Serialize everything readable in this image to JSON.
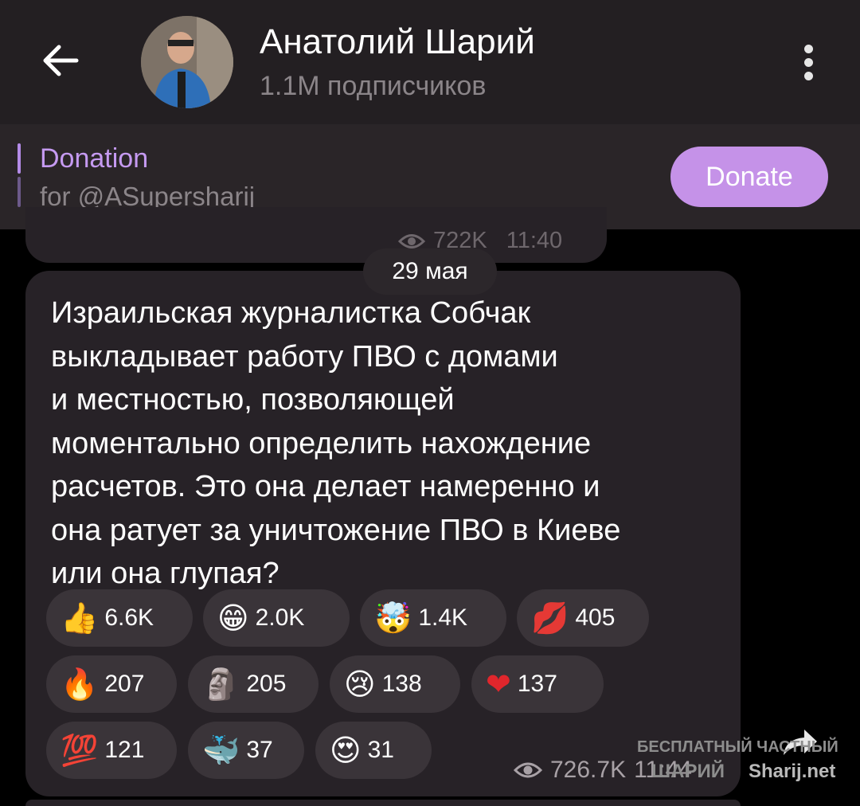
{
  "header": {
    "title": "Анатолий Шарий",
    "subtitle": "1.1M подписчиков",
    "back_icon": "arrow-left-icon",
    "menu_icon": "more-vertical-icon"
  },
  "pinned": {
    "title": "Donation",
    "subtitle": "for @ASupersharij",
    "button_label": "Donate",
    "accent": "#c592e8"
  },
  "previous_message": {
    "views": "722K",
    "time": "11:40"
  },
  "date_separator": "29 мая",
  "message": {
    "lines": [
      "Израильская журналистка Собчак",
      "выкладывает работу ПВО с домами",
      "и местностью, позволяющей",
      "моментально определить нахождение",
      "расчетов. Это она делает намеренно и",
      "она ратует за уничтожение ПВО в Киеве",
      "или она глупая?"
    ],
    "views": "726.7K",
    "time": "11:44",
    "reactions": [
      {
        "emoji": "👍",
        "count": "6.6K"
      },
      {
        "emoji": "😁",
        "count": "2.0K"
      },
      {
        "emoji": "🤯",
        "count": "1.4K"
      },
      {
        "emoji": "💋",
        "count": "405"
      },
      {
        "emoji": "🔥",
        "count": "207"
      },
      {
        "emoji": "🗿",
        "count": "205"
      },
      {
        "emoji": "😢",
        "count": "138"
      },
      {
        "emoji": "❤",
        "count": "137"
      },
      {
        "emoji": "💯",
        "count": "121"
      },
      {
        "emoji": "🐳",
        "count": "37"
      },
      {
        "emoji": "😍",
        "count": "31"
      }
    ]
  },
  "watermark": {
    "line1": "БЕСПЛАТНЫЙ ЧАСТНЫЙ",
    "line2": "ШАРИЙ",
    "line3": "Sharij.net"
  }
}
